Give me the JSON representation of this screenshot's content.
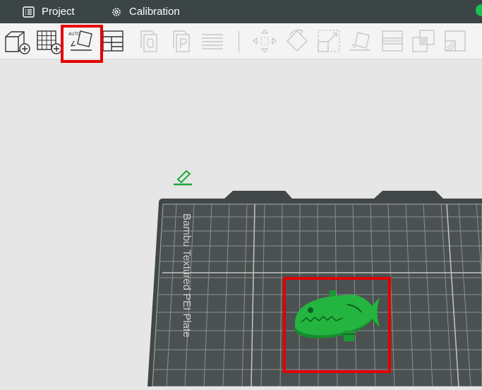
{
  "topbar": {
    "tabs": [
      {
        "label": "Project",
        "icon": "project-list-icon"
      },
      {
        "label": "Calibration",
        "icon": "gear-icon"
      }
    ],
    "status_color": "#19c152"
  },
  "toolbar": {
    "tools": [
      {
        "name": "add-cube-button",
        "icon": "add-cube-icon",
        "enabled": true
      },
      {
        "name": "add-plate-button",
        "icon": "grid-plus-icon",
        "enabled": true
      },
      {
        "name": "auto-orient-button",
        "icon": "auto-orient-icon",
        "enabled": true,
        "highlighted": true,
        "badge": "AUTO"
      },
      {
        "name": "arrange-button",
        "icon": "arrange-layout-icon",
        "enabled": true
      },
      {
        "name": "copy-button",
        "icon": "copy-icon",
        "enabled": false
      },
      {
        "name": "paste-button",
        "icon": "paste-icon",
        "enabled": false
      },
      {
        "name": "layers-button",
        "icon": "layers-icon",
        "enabled": false
      },
      {
        "name": "move-button",
        "icon": "move-icon",
        "enabled": false
      },
      {
        "name": "rotate-button",
        "icon": "rotate-icon",
        "enabled": false
      },
      {
        "name": "scale-button",
        "icon": "scale-icon",
        "enabled": false
      },
      {
        "name": "lay-on-face-button",
        "icon": "lay-on-face-icon",
        "enabled": false
      },
      {
        "name": "cut-button",
        "icon": "cut-icon",
        "enabled": false
      },
      {
        "name": "boolean-button",
        "icon": "boolean-icon",
        "enabled": false
      },
      {
        "name": "support-paint-button",
        "icon": "support-paint-icon",
        "enabled": false
      }
    ]
  },
  "viewport": {
    "plate_label": "Bambu Textured PEI Plate",
    "plate_color": "#4a4f4f",
    "grid_color": "#8a8f8f",
    "model_color": "#1fa93a",
    "model_name": "fish-model",
    "highlight_color": "#e30000"
  }
}
